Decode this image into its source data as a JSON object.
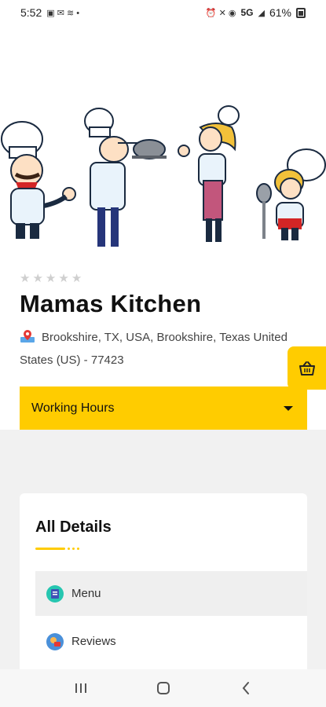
{
  "status_bar": {
    "time": "5:52",
    "network": "5G",
    "battery": "61%"
  },
  "restaurant": {
    "rating_stars": 0,
    "rating_max": 5,
    "name": "Mamas Kitchen",
    "address": "Brookshire, TX, USA, Brookshire, Texas United States (US) - 77423"
  },
  "working_hours": {
    "label": "Working Hours"
  },
  "details": {
    "title": "All Details",
    "items": [
      {
        "label": "Menu",
        "icon": "menu-book-icon"
      },
      {
        "label": "Reviews",
        "icon": "reviews-icon"
      }
    ]
  },
  "colors": {
    "accent": "#FFCC00",
    "text": "#111111"
  }
}
